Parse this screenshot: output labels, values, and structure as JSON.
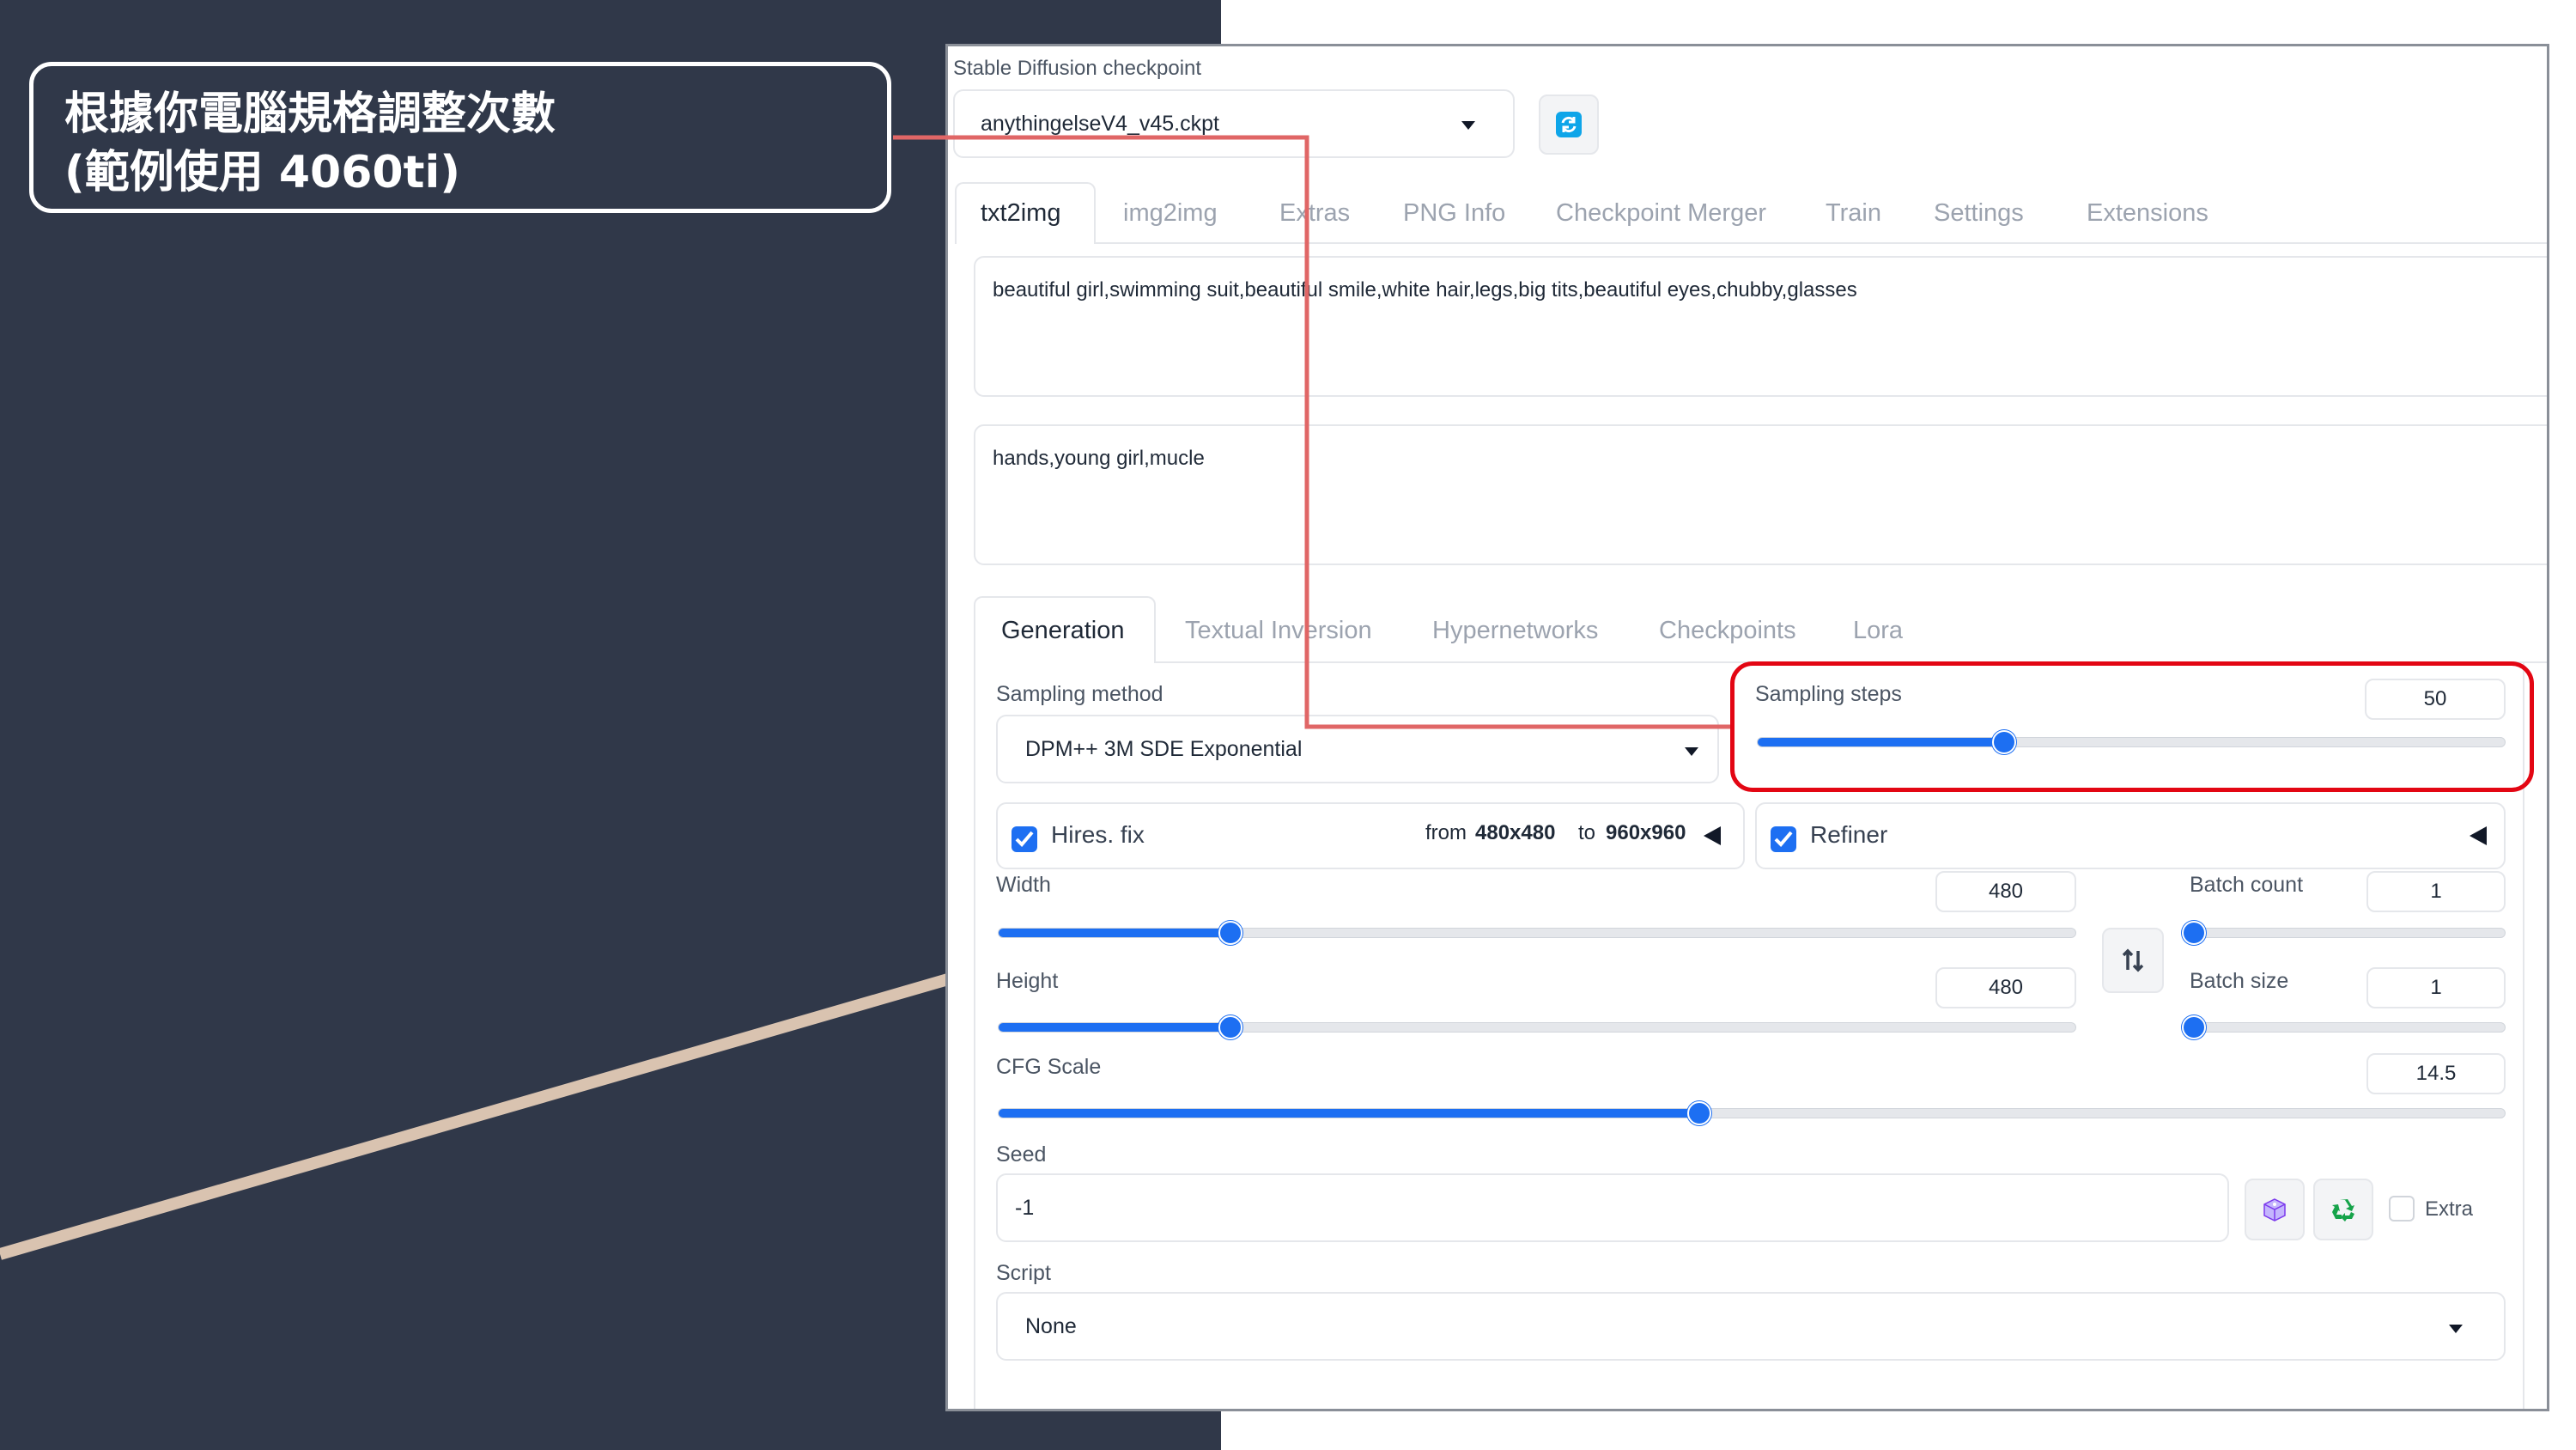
{
  "callout": {
    "line1": "根據你電腦規格調整次數",
    "line2": "(範例使用 4060ti)"
  },
  "checkpoint": {
    "label": "Stable Diffusion checkpoint",
    "value": "anythingelseV4_v45.ckpt",
    "refresh_icon": "refresh-icon"
  },
  "main_tabs": [
    "txt2img",
    "img2img",
    "Extras",
    "PNG Info",
    "Checkpoint Merger",
    "Train",
    "Settings",
    "Extensions"
  ],
  "prompt": {
    "positive": "beautiful girl,swimming suit,beautiful smile,white hair,legs,big tits,beautiful eyes,chubby,glasses",
    "negative": "hands,young girl,mucle"
  },
  "sub_tabs": [
    "Generation",
    "Textual Inversion",
    "Hypernetworks",
    "Checkpoints",
    "Lora"
  ],
  "sampling_method": {
    "label": "Sampling method",
    "value": "DPM++ 3M SDE Exponential"
  },
  "sampling_steps": {
    "label": "Sampling steps",
    "value": "50",
    "fraction": 0.33
  },
  "hires": {
    "label": "Hires. fix",
    "checked": true,
    "from_prefix": "from",
    "from": "480x480",
    "to_prefix": "to",
    "to": "960x960"
  },
  "refiner": {
    "label": "Refiner",
    "checked": true
  },
  "width": {
    "label": "Width",
    "value": "480",
    "fraction": 0.215
  },
  "height": {
    "label": "Height",
    "value": "480",
    "fraction": 0.215
  },
  "batch_count": {
    "label": "Batch count",
    "value": "1",
    "fraction": 0.0
  },
  "batch_size": {
    "label": "Batch size",
    "value": "1",
    "fraction": 0.0
  },
  "cfg_scale": {
    "label": "CFG Scale",
    "value": "14.5",
    "fraction": 0.465
  },
  "seed": {
    "label": "Seed",
    "value": "-1",
    "extra_label": "Extra"
  },
  "script": {
    "label": "Script",
    "value": "None"
  },
  "colors": {
    "slide": "#303849",
    "accent": "#1d6ff2",
    "highlight": "#e30613",
    "connector": "#e06666",
    "stripe": "#d9c3b0"
  }
}
